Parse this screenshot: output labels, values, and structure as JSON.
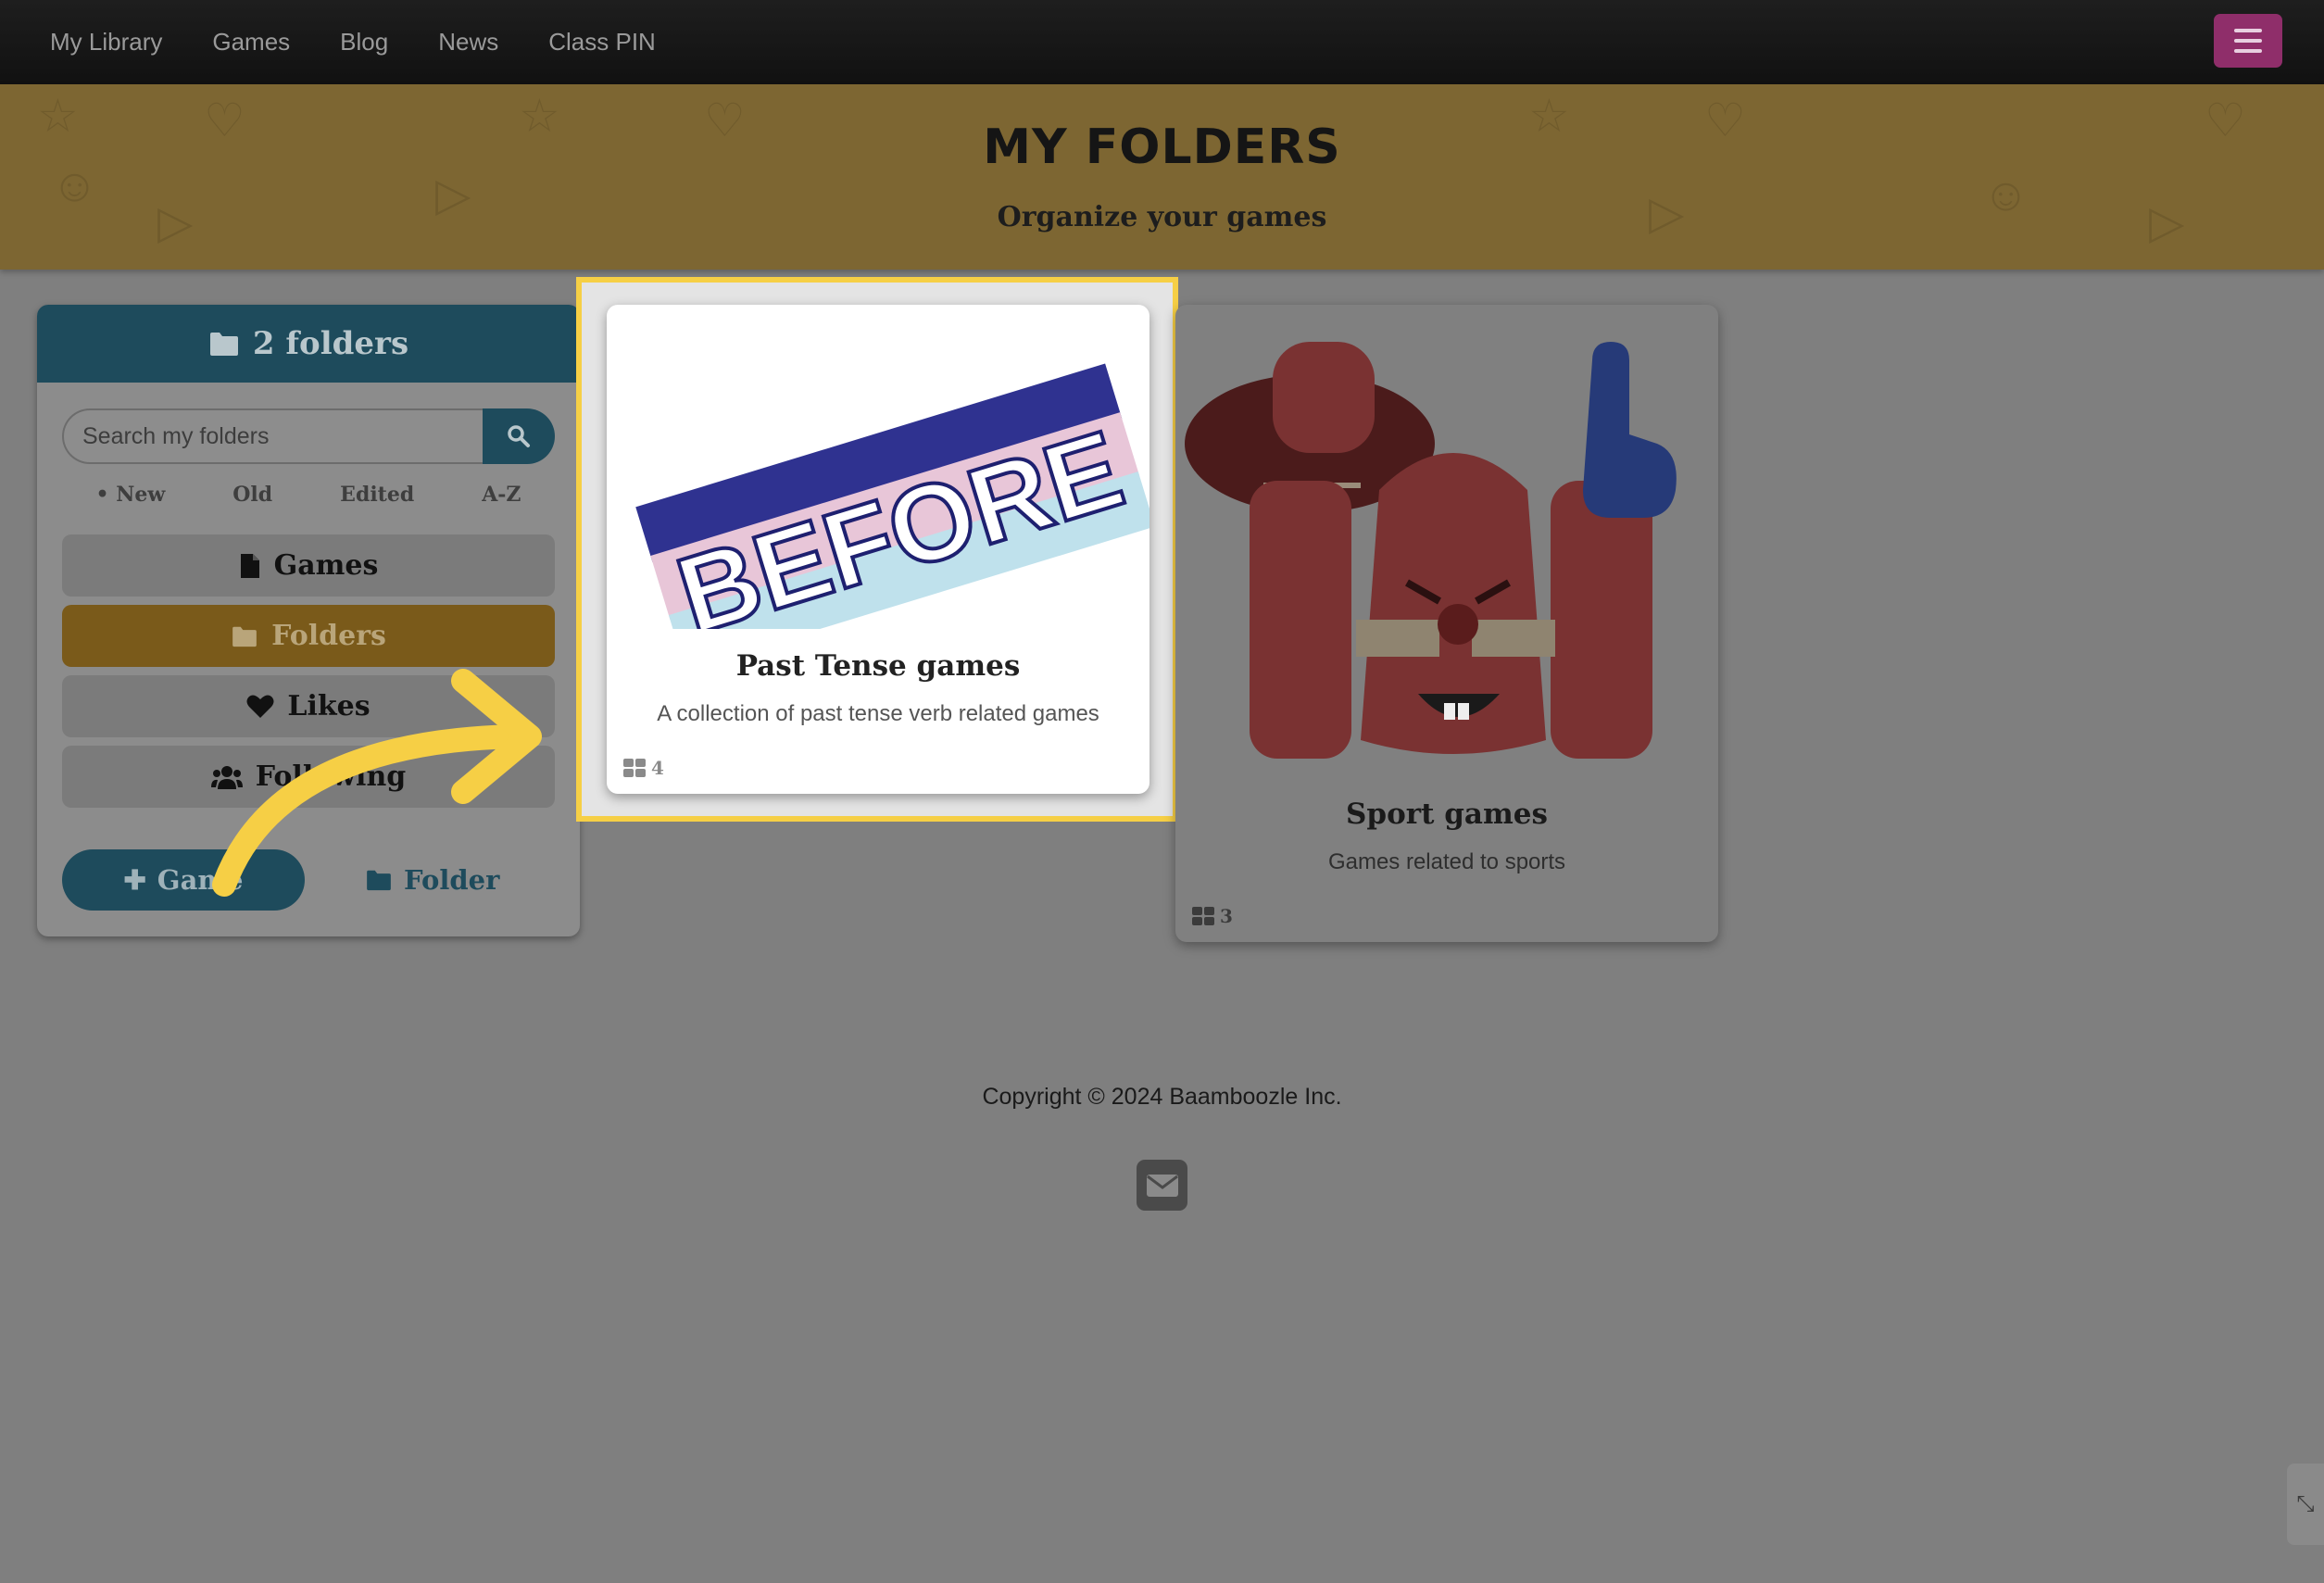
{
  "nav": {
    "links": [
      "My Library",
      "Games",
      "Blog",
      "News",
      "Class PIN"
    ]
  },
  "banner": {
    "title": "MY FOLDERS",
    "subtitle": "Organize your games"
  },
  "sidebar": {
    "header": "2 folders",
    "search_placeholder": "Search my folders",
    "sort_options": [
      "• New",
      "Old",
      "Edited",
      "A-Z"
    ],
    "filters": [
      {
        "label": "Games",
        "icon": "file-icon"
      },
      {
        "label": "Folders",
        "icon": "folder-icon",
        "active": true
      },
      {
        "label": "Likes",
        "icon": "heart-icon"
      },
      {
        "label": "Following",
        "icon": "users-icon"
      }
    ],
    "add_game_label": "Game",
    "add_folder_label": "Folder"
  },
  "folders": [
    {
      "title": "Past Tense games",
      "description": "A collection of past tense verb related games",
      "count": "4",
      "image_text": "BEFORE",
      "highlighted": true
    },
    {
      "title": "Sport games",
      "description": "Games related to sports",
      "count": "3"
    }
  ],
  "footer": {
    "copyright": "Copyright © 2024 Baamboozle Inc."
  },
  "colors": {
    "accent_teal": "#1e4b5c",
    "highlight_yellow": "#f6cf45",
    "menu_magenta": "#8f2e6a"
  }
}
